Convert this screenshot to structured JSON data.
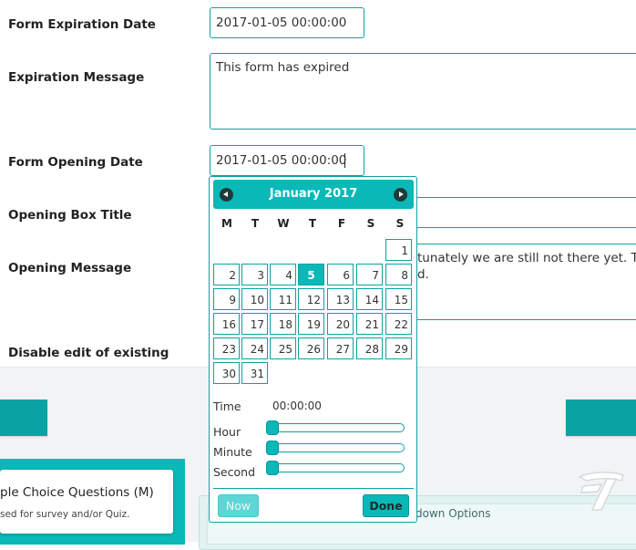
{
  "form": {
    "expiration_date": {
      "label": "Form Expiration Date",
      "value": "2017-01-05 00:00:00"
    },
    "expiration_message": {
      "label": "Expiration Message",
      "value": "This form has expired"
    },
    "opening_date": {
      "label": "Form Opening Date",
      "value": "2017-01-05 00:00:00"
    },
    "opening_box_title": {
      "label": "Opening Box Title",
      "value": ""
    },
    "opening_message": {
      "label": "Opening Message",
      "line1": "tunately we are still not there yet. Tal",
      "line2": "d."
    },
    "disable_edit": {
      "label": "Disable edit of existing"
    }
  },
  "lower": {
    "card_title": "ple Choice Questions (M)",
    "card_desc": "sed for survey and/or Quiz.",
    "dropdown_text": "down Options"
  },
  "datepicker": {
    "month_title": "January 2017",
    "weekdays": [
      "M",
      "T",
      "W",
      "T",
      "F",
      "S",
      "S"
    ],
    "days": [
      "1",
      "2",
      "3",
      "4",
      "5",
      "6",
      "7",
      "8",
      "9",
      "10",
      "11",
      "12",
      "13",
      "14",
      "15",
      "16",
      "17",
      "18",
      "19",
      "20",
      "21",
      "22",
      "23",
      "24",
      "25",
      "26",
      "27",
      "28",
      "29",
      "30",
      "31"
    ],
    "selected_day": "5",
    "time_label": "Time",
    "time_value": "00:00:00",
    "hour_label": "Hour",
    "minute_label": "Minute",
    "second_label": "Second",
    "hour": 0,
    "minute": 0,
    "second": 0,
    "now_label": "Now",
    "done_label": "Done"
  },
  "colors": {
    "accent": "#0ab8b8",
    "border": "#0aa3a3"
  }
}
